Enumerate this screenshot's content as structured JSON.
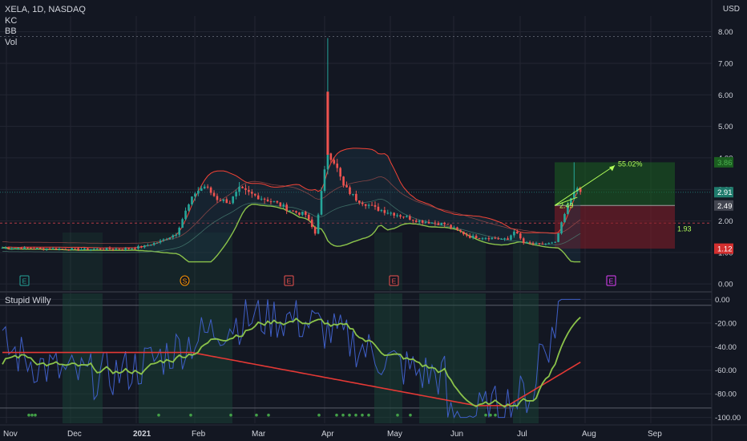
{
  "legend": {
    "symbol": "XELA, 1D, NASDAQ",
    "ind1": "KC",
    "ind2": "BB",
    "ind3": "Vol"
  },
  "currency": "USD",
  "oscillator_title": "Stupid Willy",
  "colors": {
    "background": "#131722",
    "grid": "#232632",
    "text": "#d1d4dc",
    "up": "#26a69a",
    "down": "#ef5350",
    "bb": "#8bc34a",
    "kc": "#f44336",
    "osc_line": "#3f5fc7",
    "osc_green": "#8bc34a",
    "osc_red": "#e53935",
    "target_zone": "#1b5e20",
    "stop_zone": "#7f1d28"
  },
  "chart_data": [
    {
      "type": "candlestick",
      "title": "XELA, 1D, NASDAQ",
      "x_axis": {
        "ticks": [
          "Nov",
          "Dec",
          "2021",
          "Feb",
          "Mar",
          "Apr",
          "May",
          "Jun",
          "Jul",
          "Aug",
          "Sep"
        ]
      },
      "y_axis": {
        "range": [
          -0.2,
          8.5
        ],
        "ticks": [
          "0.00",
          "1.00",
          "2.00",
          "3.00",
          "4.00",
          "5.00",
          "6.00",
          "7.00",
          "8.00"
        ]
      },
      "price_labels": [
        {
          "value": 3.86,
          "text": "3.86",
          "kind": "target"
        },
        {
          "value": 2.91,
          "text": "2.91",
          "kind": "last"
        },
        {
          "value": 2.49,
          "text": "2.49",
          "kind": "entry"
        },
        {
          "value": 1.12,
          "text": "1.12",
          "kind": "stop"
        }
      ],
      "position_tool": {
        "entry": 2.49,
        "target": 3.86,
        "stop": 1.12,
        "target_pct_label": "55.02%",
        "entry_label": "2.49",
        "mid_label": "1.93"
      },
      "earnings_markers": [
        "E",
        "S",
        "E",
        "E",
        "E"
      ],
      "key_prices": {
        "feb_high": 3.5,
        "mar_spike_high": 7.8,
        "jun_low": 1.2,
        "jul_high": 3.86,
        "last": 2.91
      }
    },
    {
      "type": "line",
      "title": "Stupid Willy",
      "y_axis": {
        "range": [
          -105,
          5
        ],
        "ticks": [
          "0.00",
          "-20.00",
          "-40.00",
          "-60.00",
          "-80.00",
          "-100.00"
        ]
      },
      "series": [
        {
          "name": "",
          "color": "#3f5fc7"
        },
        {
          "name": "",
          "color": "#8bc34a"
        },
        {
          "name": "",
          "color": "#e53935"
        }
      ]
    }
  ]
}
